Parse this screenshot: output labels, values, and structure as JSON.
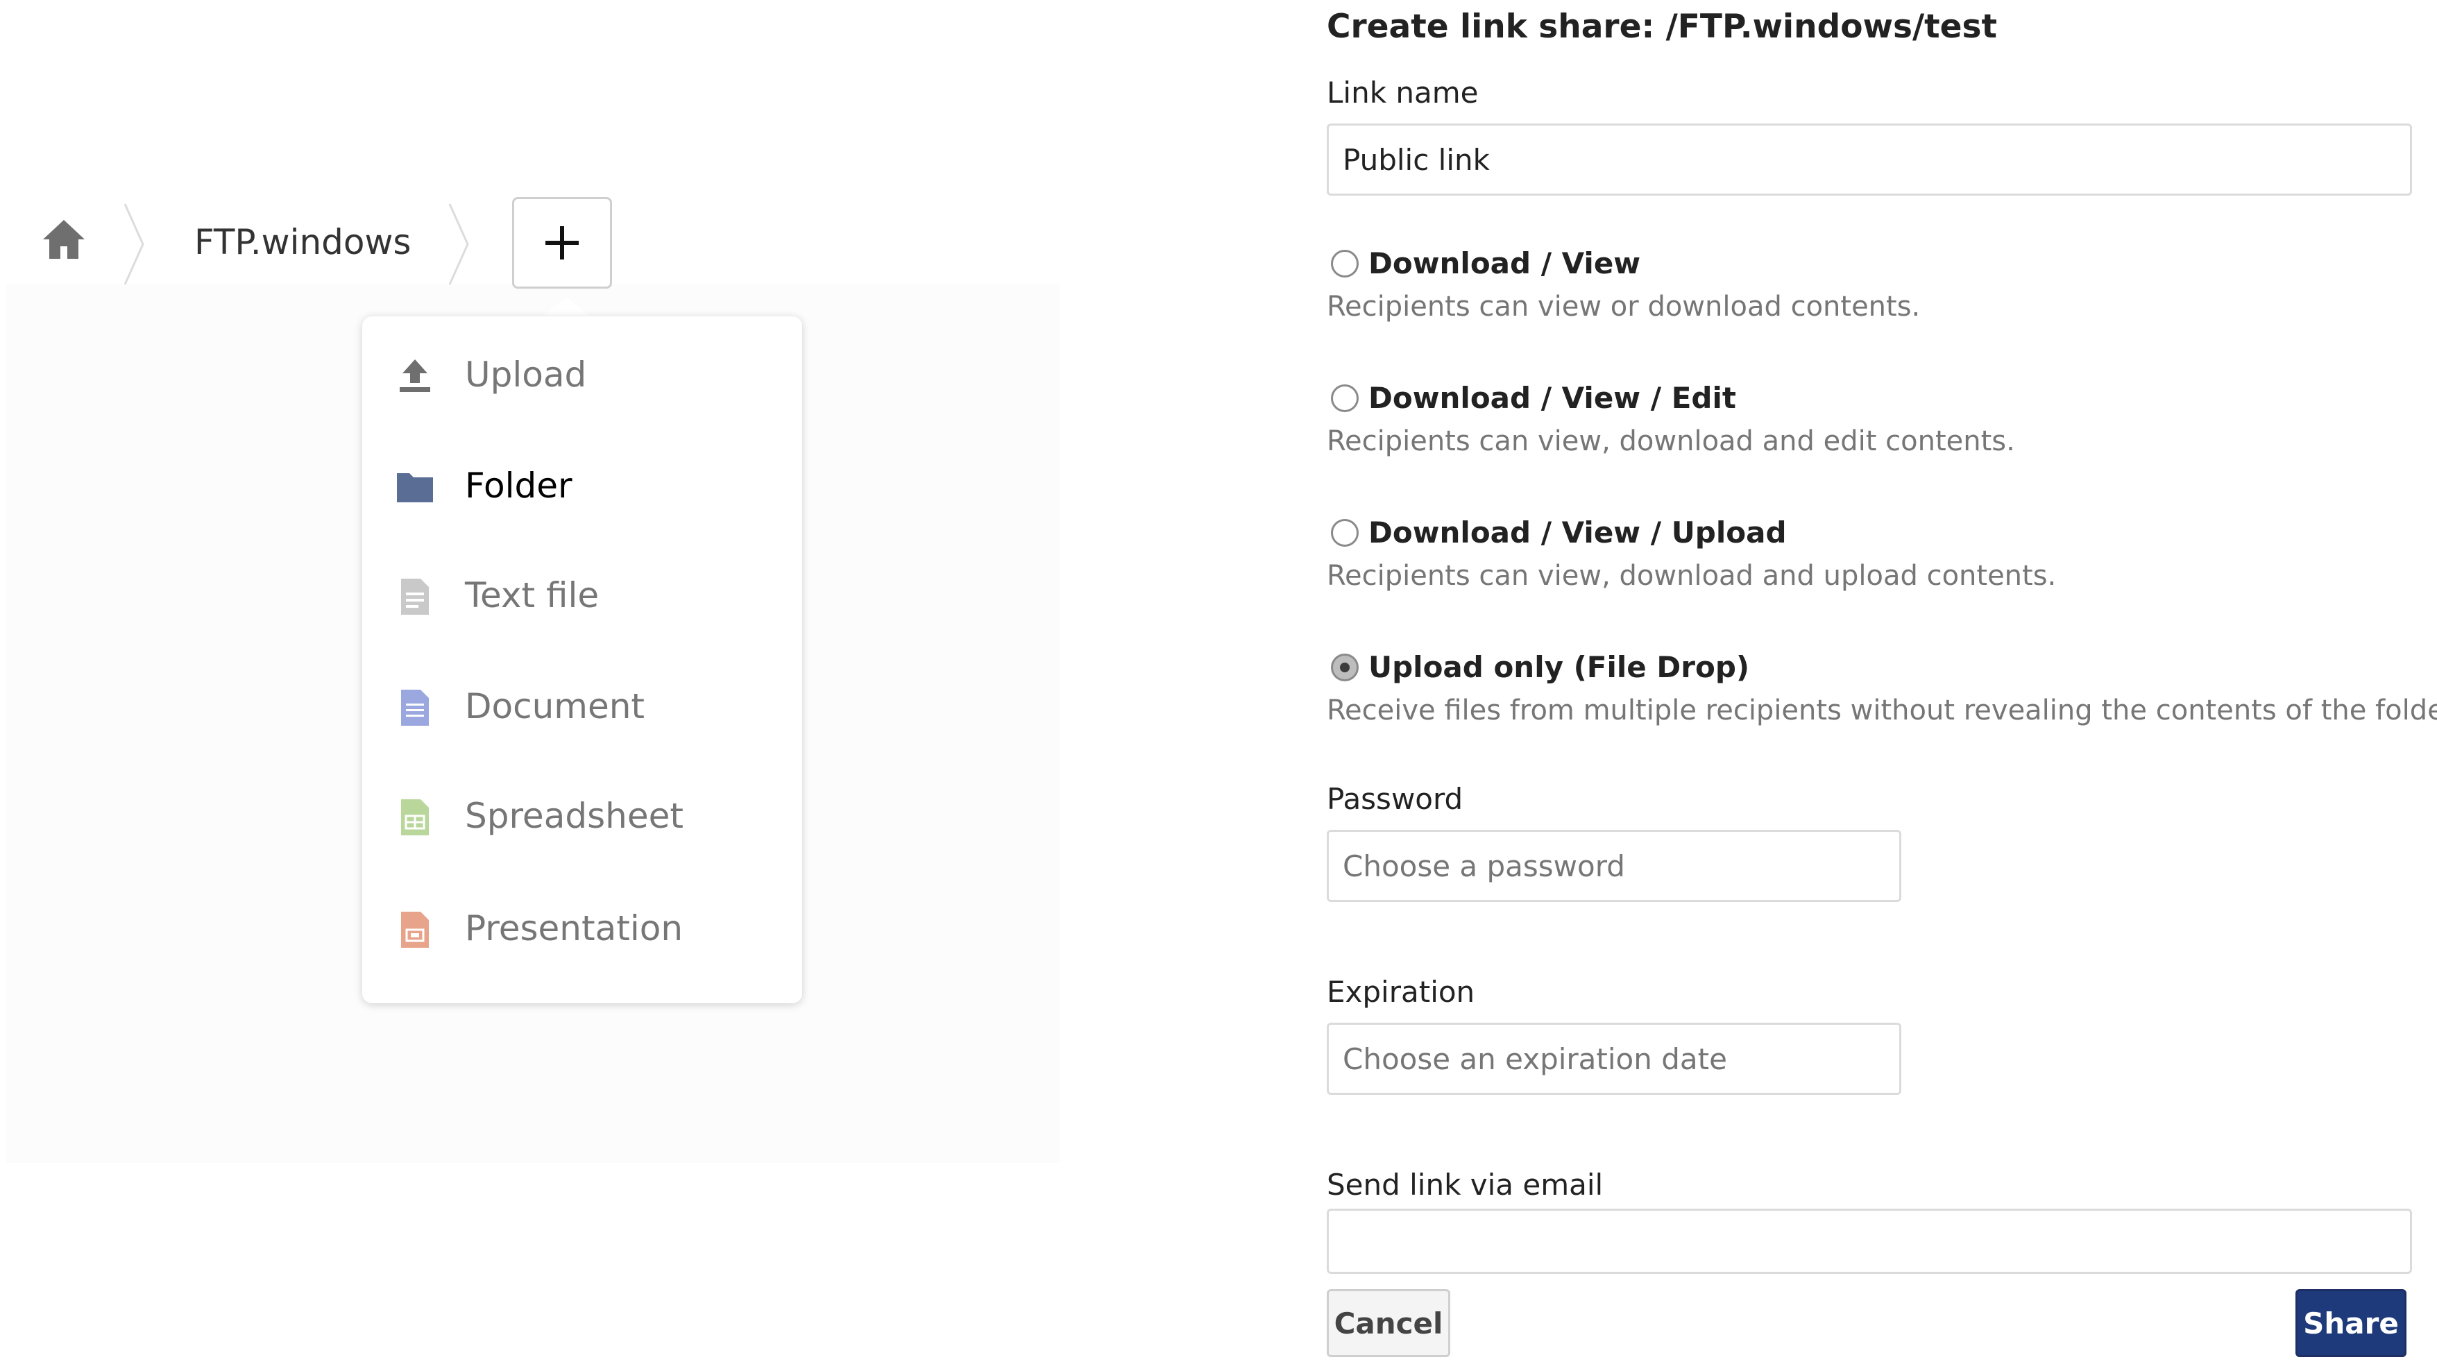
{
  "breadcrumb": {
    "home_icon": "home-icon",
    "folder": "FTP.windows",
    "add_icon": "plus-icon"
  },
  "new_menu": {
    "items": [
      {
        "label": "Upload",
        "icon": "upload-icon",
        "color": "#6f6f6f"
      },
      {
        "label": "Folder",
        "icon": "folder-icon",
        "color": "#5a6d94"
      },
      {
        "label": "Text file",
        "icon": "text-file-icon",
        "color": "#c9c9c9"
      },
      {
        "label": "Document",
        "icon": "document-icon",
        "color": "#9ba8e0"
      },
      {
        "label": "Spreadsheet",
        "icon": "spreadsheet-icon",
        "color": "#b9d69b"
      },
      {
        "label": "Presentation",
        "icon": "presentation-icon",
        "color": "#e8a48a"
      }
    ],
    "active": "Folder"
  },
  "share_form": {
    "title": "Create link share: /FTP.windows/test",
    "link_name_label": "Link name",
    "link_name_value": "Public link",
    "options": [
      {
        "label": "Download / View",
        "desc": "Recipients can view or download contents.",
        "checked": false
      },
      {
        "label": "Download / View / Edit",
        "desc": "Recipients can view, download and edit contents.",
        "checked": false
      },
      {
        "label": "Download / View / Upload",
        "desc": "Recipients can view, download and upload contents.",
        "checked": false
      },
      {
        "label": "Upload only (File Drop)",
        "desc": "Receive files from multiple recipients without revealing the contents of the folder.",
        "checked": true
      }
    ],
    "password_label": "Password",
    "password_placeholder": "Choose a password",
    "expiration_label": "Expiration",
    "expiration_placeholder": "Choose an expiration date",
    "email_label": "Send link via email",
    "email_value": "",
    "cancel_label": "Cancel",
    "share_label": "Share",
    "colors": {
      "share_button": "#1e3a7a"
    }
  }
}
